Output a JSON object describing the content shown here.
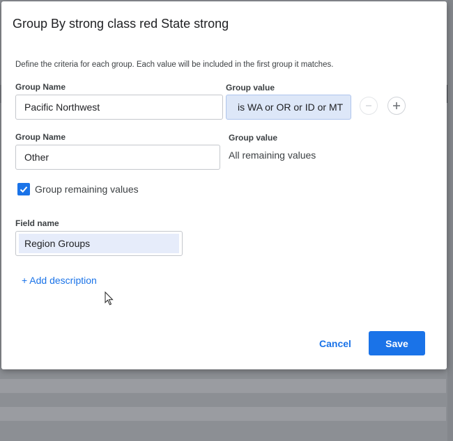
{
  "dialog": {
    "title": "Group By strong class red State strong",
    "instructions": "Define the criteria for each group. Each value will be included in the first group it matches."
  },
  "groups": [
    {
      "name_label": "Group Name",
      "name_value": "Pacific Northwest",
      "value_label": "Group value",
      "value_text": "is WA or OR or ID or MT",
      "remove_icon": "minus-circle-icon",
      "add_icon": "plus-circle-icon"
    },
    {
      "name_label": "Group Name",
      "name_value": "Other",
      "value_label": "Group value",
      "value_text": "All remaining values"
    }
  ],
  "group_remaining": {
    "label": "Group remaining values",
    "checked": true
  },
  "field": {
    "label": "Field name",
    "value": "Region Groups"
  },
  "add_description": "+ Add description",
  "buttons": {
    "cancel": "Cancel",
    "save": "Save"
  },
  "colors": {
    "accent": "#1a73e8",
    "chip_bg": "#dde7f8",
    "selected_text_bg": "#e6ecfa"
  }
}
